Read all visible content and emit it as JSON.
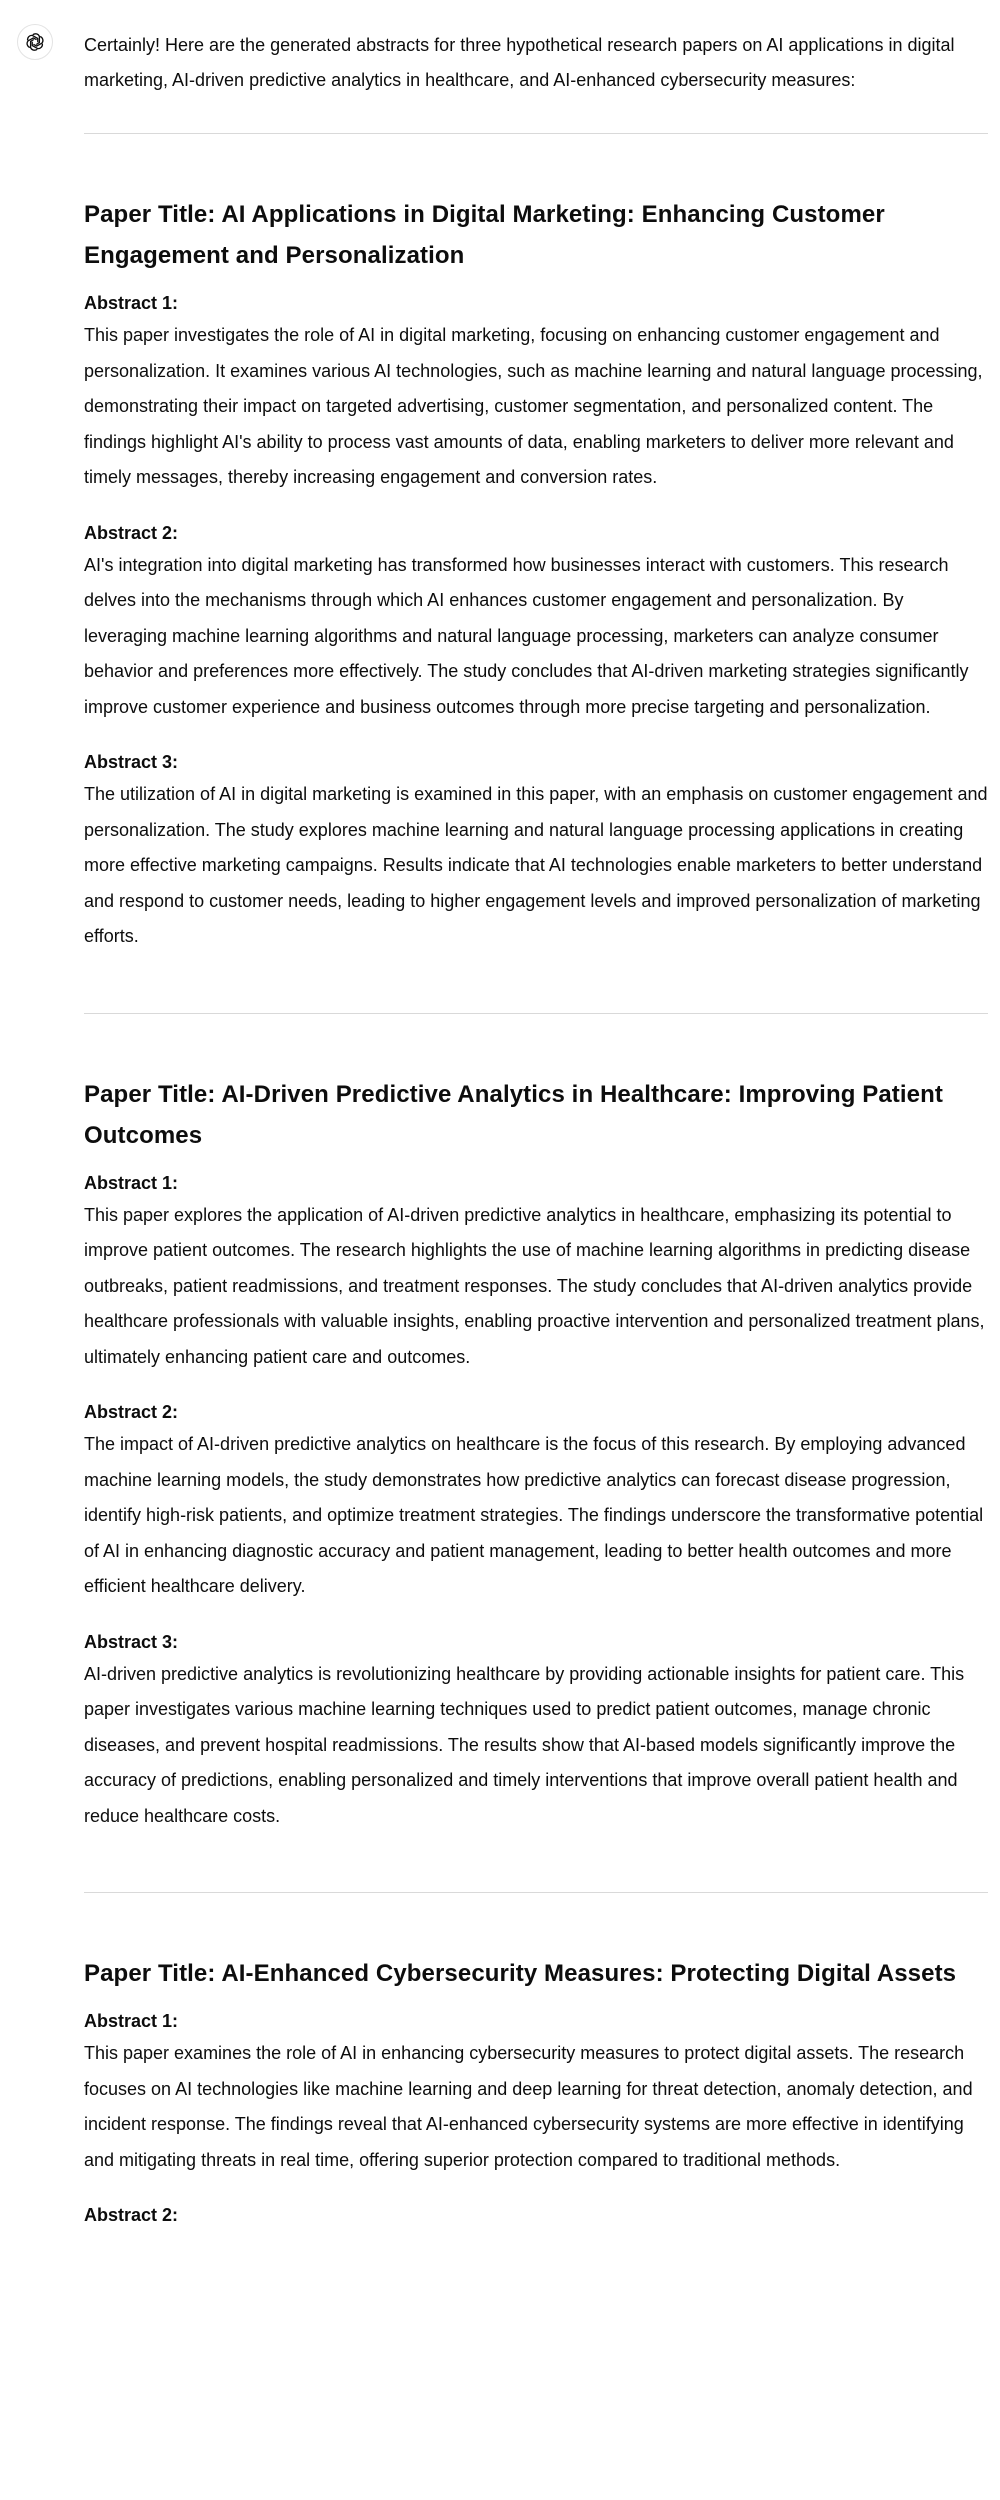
{
  "assistant": {
    "avatar_icon": "openai-logo-icon",
    "intro": "Certainly! Here are the generated abstracts for three hypothetical research papers on AI applications in digital marketing, AI-driven predictive analytics in healthcare, and AI-enhanced cybersecurity measures:"
  },
  "papers": [
    {
      "title": "Paper Title: AI Applications in Digital Marketing: Enhancing Customer Engagement and Personalization",
      "abstracts": [
        {
          "label": "Abstract 1:",
          "text": "This paper investigates the role of AI in digital marketing, focusing on enhancing customer engagement and personalization. It examines various AI technologies, such as machine learning and natural language processing, demonstrating their impact on targeted advertising, customer segmentation, and personalized content. The findings highlight AI's ability to process vast amounts of data, enabling marketers to deliver more relevant and timely messages, thereby increasing engagement and conversion rates."
        },
        {
          "label": "Abstract 2:",
          "text": "AI's integration into digital marketing has transformed how businesses interact with customers. This research delves into the mechanisms through which AI enhances customer engagement and personalization. By leveraging machine learning algorithms and natural language processing, marketers can analyze consumer behavior and preferences more effectively. The study concludes that AI-driven marketing strategies significantly improve customer experience and business outcomes through more precise targeting and personalization."
        },
        {
          "label": "Abstract 3:",
          "text": "The utilization of AI in digital marketing is examined in this paper, with an emphasis on customer engagement and personalization. The study explores machine learning and natural language processing applications in creating more effective marketing campaigns. Results indicate that AI technologies enable marketers to better understand and respond to customer needs, leading to higher engagement levels and improved personalization of marketing efforts."
        }
      ]
    },
    {
      "title": "Paper Title: AI-Driven Predictive Analytics in Healthcare: Improving Patient Outcomes",
      "abstracts": [
        {
          "label": "Abstract 1:",
          "text": "This paper explores the application of AI-driven predictive analytics in healthcare, emphasizing its potential to improve patient outcomes. The research highlights the use of machine learning algorithms in predicting disease outbreaks, patient readmissions, and treatment responses. The study concludes that AI-driven analytics provide healthcare professionals with valuable insights, enabling proactive intervention and personalized treatment plans, ultimately enhancing patient care and outcomes."
        },
        {
          "label": "Abstract 2:",
          "text": "The impact of AI-driven predictive analytics on healthcare is the focus of this research. By employing advanced machine learning models, the study demonstrates how predictive analytics can forecast disease progression, identify high-risk patients, and optimize treatment strategies. The findings underscore the transformative potential of AI in enhancing diagnostic accuracy and patient management, leading to better health outcomes and more efficient healthcare delivery."
        },
        {
          "label": "Abstract 3:",
          "text": "AI-driven predictive analytics is revolutionizing healthcare by providing actionable insights for patient care. This paper investigates various machine learning techniques used to predict patient outcomes, manage chronic diseases, and prevent hospital readmissions. The results show that AI-based models significantly improve the accuracy of predictions, enabling personalized and timely interventions that improve overall patient health and reduce healthcare costs."
        }
      ]
    },
    {
      "title": "Paper Title: AI-Enhanced Cybersecurity Measures: Protecting Digital Assets",
      "abstracts": [
        {
          "label": "Abstract 1:",
          "text": "This paper examines the role of AI in enhancing cybersecurity measures to protect digital assets. The research focuses on AI technologies like machine learning and deep learning for threat detection, anomaly detection, and incident response. The findings reveal that AI-enhanced cybersecurity systems are more effective in identifying and mitigating threats in real time, offering superior protection compared to traditional methods."
        },
        {
          "label": "Abstract 2:",
          "text": ""
        }
      ]
    }
  ]
}
